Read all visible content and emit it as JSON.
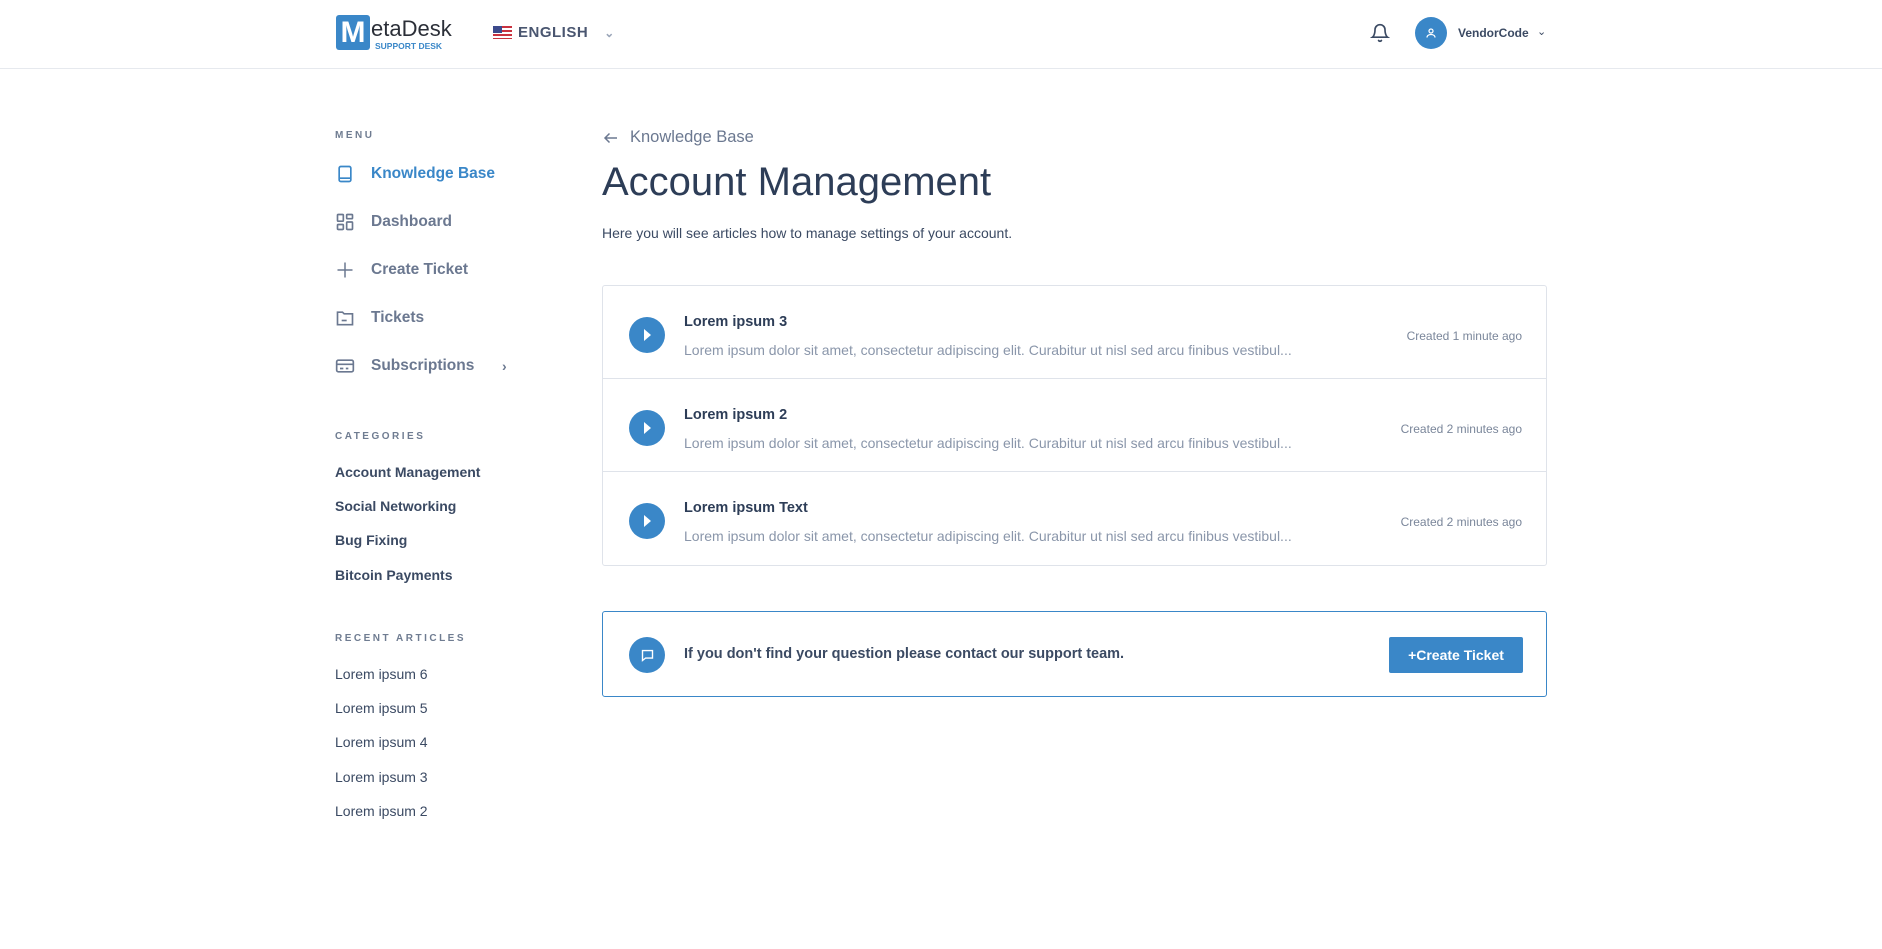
{
  "header": {
    "logo_letter": "M",
    "logo_name": "etaDesk",
    "logo_sub": "SUPPORT DESK",
    "language": "ENGLISH",
    "username": "VendorCode"
  },
  "sidebar": {
    "menu_heading": "MENU",
    "menu": [
      {
        "label": "Knowledge Base"
      },
      {
        "label": "Dashboard"
      },
      {
        "label": "Create Ticket"
      },
      {
        "label": "Tickets"
      },
      {
        "label": "Subscriptions"
      }
    ],
    "categories_heading": "CATEGORIES",
    "categories": [
      "Account Management",
      "Social Networking",
      "Bug Fixing",
      "Bitcoin Payments"
    ],
    "recent_heading": "RECENT ARTICLES",
    "recent": [
      "Lorem ipsum 6",
      "Lorem ipsum 5",
      "Lorem ipsum 4",
      "Lorem ipsum 3",
      "Lorem ipsum 2"
    ]
  },
  "main": {
    "back_label": "Knowledge Base",
    "title": "Account Management",
    "description": "Here you will see articles how to manage settings of your account.",
    "articles": [
      {
        "title": "Lorem ipsum 3",
        "excerpt": "Lorem ipsum dolor sit amet, consectetur adipiscing elit. Curabitur ut nisl sed arcu finibus vestibul...",
        "created": "Created 1 minute ago"
      },
      {
        "title": "Lorem ipsum 2",
        "excerpt": "Lorem ipsum dolor sit amet, consectetur adipiscing elit. Curabitur ut nisl sed arcu finibus vestibul...",
        "created": "Created 2 minutes ago"
      },
      {
        "title": "Lorem ipsum Text",
        "excerpt": "Lorem ipsum dolor sit amet, consectetur adipiscing elit. Curabitur ut nisl sed arcu finibus vestibul...",
        "created": "Created 2 minutes ago"
      }
    ],
    "support_text": "If you don't find your question please contact our support team.",
    "create_ticket_label": "+Create Ticket"
  },
  "colors": {
    "accent": "#3a87c8",
    "text": "#3b4a63",
    "muted": "#8a96aa"
  }
}
